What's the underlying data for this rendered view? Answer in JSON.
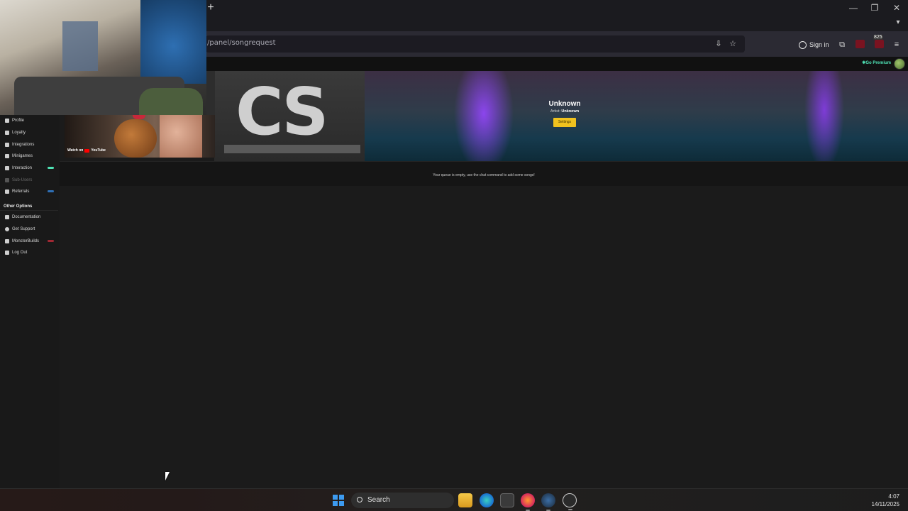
{
  "browser": {
    "new_tab_label": "+",
    "url": "/panel/songrequest",
    "sign_in_label": "Sign in",
    "extension_badge": "825",
    "window_controls": {
      "minimize": "—",
      "restore": "❐",
      "close": "✕"
    }
  },
  "site": {
    "premium_label": "✱Go Premium"
  },
  "sidebar": {
    "items": [
      {
        "label": "Profile",
        "icon": "profile-icon"
      },
      {
        "label": "Loyalty",
        "icon": "trophy-icon"
      },
      {
        "label": "Integrations",
        "icon": "integrations-icon"
      },
      {
        "label": "Minigames",
        "icon": "gamepad-icon"
      },
      {
        "label": "Interaction",
        "icon": "music-icon",
        "badge_color": "#4fe3b5"
      },
      {
        "label": "Sub-Users",
        "icon": "users-icon",
        "disabled": true
      },
      {
        "label": "Referrals",
        "icon": "referrals-icon",
        "badge_color": "#2f6fb5"
      }
    ],
    "other_options_title": "Other Options",
    "other_items": [
      {
        "label": "Documentation",
        "icon": "book-icon"
      },
      {
        "label": "Get Support",
        "icon": "support-icon"
      },
      {
        "label": "MonsterBuilds",
        "icon": "monster-icon",
        "badge_color": "#a12833"
      },
      {
        "label": "Log Out",
        "icon": "logout-icon"
      }
    ]
  },
  "now_playing": {
    "title": "Unknown",
    "artist_label": "Artist:",
    "artist": "Unknown",
    "settings_label": "Settings",
    "logo_text": "CS"
  },
  "queue": {
    "empty_message": "Your queue is empty, use the chat command to add some songs!"
  },
  "webcam": {
    "watch_on_label": "Watch on",
    "youtube_label": "YouTube"
  },
  "taskbar": {
    "search_label": "Search",
    "time": "4:07",
    "date": "14/11/2025"
  },
  "colors": {
    "accent_yellow": "#f0c21e",
    "premium_green": "#4fe3b5",
    "start_blue": "#3d9bf0"
  }
}
